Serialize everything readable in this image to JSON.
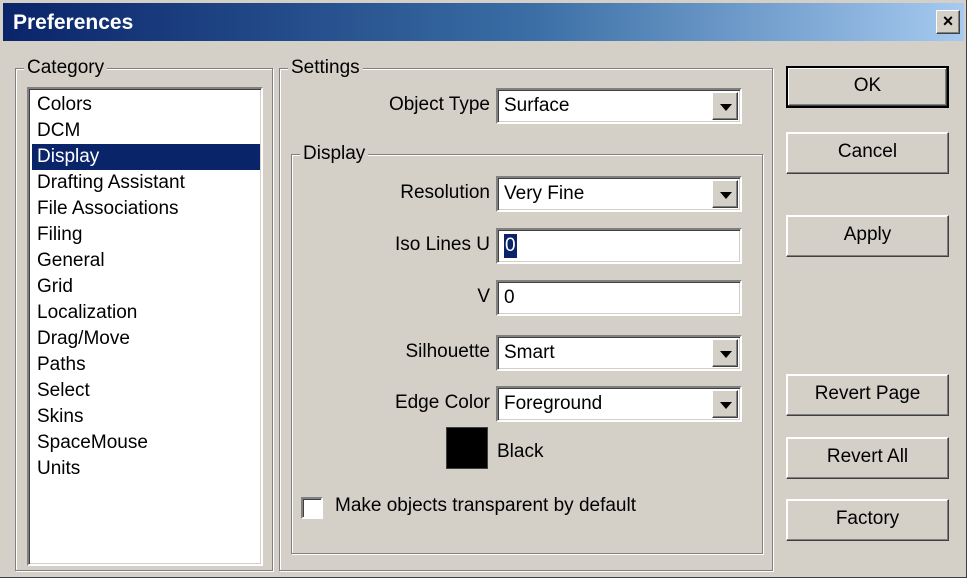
{
  "window": {
    "title": "Preferences",
    "close_label": "×"
  },
  "category": {
    "legend": "Category",
    "items": [
      "Colors",
      "DCM",
      "Display",
      "Drafting Assistant",
      "File Associations",
      "Filing",
      "General",
      "Grid",
      "Localization",
      "Drag/Move",
      "Paths",
      "Select",
      "Skins",
      "SpaceMouse",
      "Units"
    ],
    "selected": "Display"
  },
  "settings": {
    "legend": "Settings",
    "object_type_label": "Object Type",
    "object_type_value": "Surface",
    "display": {
      "legend": "Display",
      "resolution_label": "Resolution",
      "resolution_value": "Very Fine",
      "iso_u_label": "Iso Lines U",
      "iso_u_value": "0",
      "iso_v_label": "V",
      "iso_v_value": "0",
      "silhouette_label": "Silhouette",
      "silhouette_value": "Smart",
      "edge_color_label": "Edge Color",
      "edge_color_value": "Foreground",
      "swatch_color": "#000000",
      "swatch_label": "Black"
    },
    "transparent_label": "Make objects transparent by default",
    "transparent_checked": false
  },
  "buttons": {
    "ok": "OK",
    "cancel": "Cancel",
    "apply": "Apply",
    "revert_page": "Revert Page",
    "revert_all": "Revert All",
    "factory": "Factory"
  },
  "colors": {
    "face": "#d4d0c8",
    "selection": "#0a246a",
    "title_start": "#0a246a",
    "title_end": "#a6caf0"
  }
}
